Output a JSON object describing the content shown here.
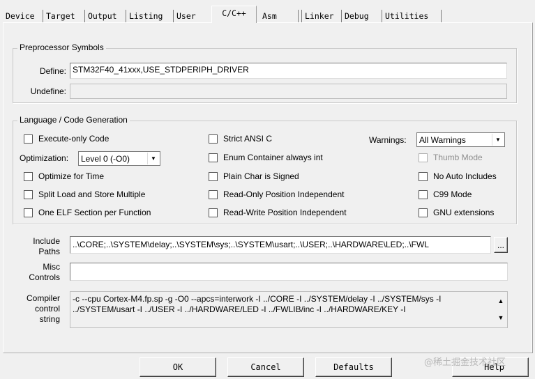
{
  "tabs": [
    "Device",
    "Target",
    "Output",
    "Listing",
    "User",
    "C/C++",
    "Asm",
    "Linker",
    "Debug",
    "Utilities"
  ],
  "preprocessor": {
    "title": "Preprocessor Symbols",
    "define_label": "Define:",
    "define_value": "STM32F40_41xxx,USE_STDPERIPH_DRIVER",
    "undefine_label": "Undefine:",
    "undefine_value": ""
  },
  "codegen": {
    "title": "Language / Code Generation",
    "execute_only": "Execute-only Code",
    "optimization_label": "Optimization:",
    "optimization_value": "Level 0 (-O0)",
    "optimize_time": "Optimize for Time",
    "split_load": "Split Load and Store Multiple",
    "one_elf": "One ELF Section per Function",
    "strict_ansi": "Strict ANSI C",
    "enum_container": "Enum Container always int",
    "plain_char": "Plain Char is Signed",
    "ro_pos": "Read-Only Position Independent",
    "rw_pos": "Read-Write Position Independent",
    "warnings_label": "Warnings:",
    "warnings_value": "All Warnings",
    "thumb_mode": "Thumb Mode",
    "no_auto_includes": "No Auto Includes",
    "c99_mode": "C99 Mode",
    "gnu_ext": "GNU extensions"
  },
  "include": {
    "label_1": "Include",
    "label_2": "Paths",
    "value": "..\\CORE;..\\SYSTEM\\delay;..\\SYSTEM\\sys;..\\SYSTEM\\usart;..\\USER;..\\HARDWARE\\LED;..\\FWL",
    "browse": "..."
  },
  "misc": {
    "label_1": "Misc",
    "label_2": "Controls",
    "value": ""
  },
  "compiler": {
    "label_1": "Compiler",
    "label_2": "control",
    "label_3": "string",
    "line_1": "-c --cpu Cortex-M4.fp.sp -g -O0 --apcs=interwork -I ../CORE -I ../SYSTEM/delay -I ../SYSTEM/sys -I",
    "line_2": "../SYSTEM/usart -I ../USER -I ../HARDWARE/LED -I ../FWLIB/inc -I ../HARDWARE/KEY -I"
  },
  "buttons": {
    "ok": "OK",
    "cancel": "Cancel",
    "defaults": "Defaults",
    "help": "Help"
  },
  "watermark": "@稀土掘金技术社区"
}
